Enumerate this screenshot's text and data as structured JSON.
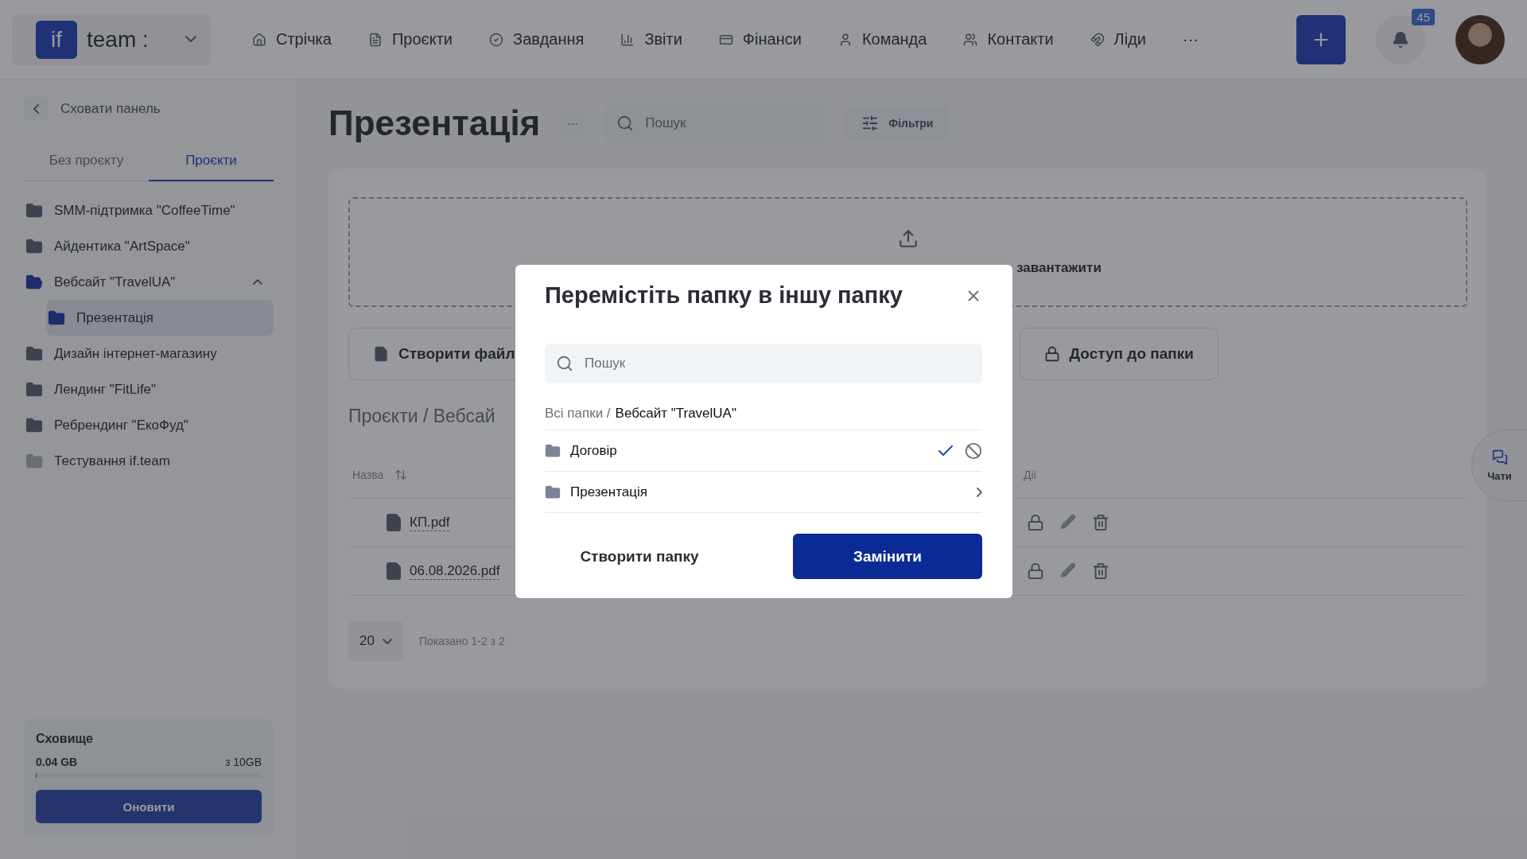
{
  "logo": {
    "mark": "if",
    "name": "team :"
  },
  "nav": [
    {
      "kind": "home",
      "label": "Стрічка"
    },
    {
      "kind": "file",
      "label": "Проєкти"
    },
    {
      "kind": "check",
      "label": "Завдання"
    },
    {
      "kind": "report",
      "label": "Звіти"
    },
    {
      "kind": "wallet",
      "label": "Фінанси"
    },
    {
      "kind": "user",
      "label": "Команда"
    },
    {
      "kind": "users",
      "label": "Контакти"
    },
    {
      "kind": "leads",
      "label": "Ліди"
    },
    {
      "kind": "more",
      "label": "···"
    }
  ],
  "notifications": {
    "count": "45"
  },
  "sidebar": {
    "hide": "Сховати панель",
    "tabs": [
      {
        "label": "Без проєкту",
        "selected": false
      },
      {
        "label": "Проєкти",
        "selected": true
      }
    ],
    "items": [
      {
        "label": "SMM-підтримка \"CoffeeTime\"",
        "selected": false,
        "inactive": false
      },
      {
        "label": "Айдентика \"ArtSpace\"",
        "selected": false,
        "inactive": false
      },
      {
        "label": "Вебсайт \"TravelUA\"",
        "selected": false,
        "inactive": false,
        "expanded": true,
        "children": [
          {
            "label": "Презентація",
            "selected": true,
            "inactive": false
          }
        ]
      },
      {
        "label": "Дизайн інтернет-магазину",
        "selected": false,
        "inactive": false
      },
      {
        "label": "Лендинг \"FitLife\"",
        "selected": false,
        "inactive": false
      },
      {
        "label": "Ребрендинг \"ЕкоФуд\"",
        "selected": false,
        "inactive": false
      },
      {
        "label": "Тестування if.team",
        "selected": false,
        "inactive": true
      }
    ],
    "storage": {
      "title": "Сховище",
      "used": "0.04 GB",
      "total": "з 10GB",
      "level": 0.004,
      "button": "Оновити"
    }
  },
  "main": {
    "title": "Презентація",
    "more": "···",
    "search": {
      "placeholder": "Пошук"
    },
    "filters": "Фільтри",
    "upload": "завантажити",
    "actions": [
      "Створити файл",
      "Доступ до папки"
    ],
    "breadcrumb": "Проєкти / Вебсай",
    "table": {
      "columns": [
        "Назва",
        "Дії"
      ],
      "rows": [
        {
          "name": "КП.pdf"
        },
        {
          "name": "06.08.2026.pdf"
        }
      ]
    },
    "pagination": {
      "size": "20",
      "shown": "Показано 1-2 з 2"
    }
  },
  "chats": "Чати",
  "modal": {
    "title": "Перемістіть папку в іншу папку",
    "search": {
      "placeholder": "Пошук"
    },
    "breadcrumb": {
      "root": "Всі папки /",
      "current": "Вебсайт \"TravelUA\""
    },
    "rows": [
      {
        "kind": "edit",
        "label": "Договір"
      },
      {
        "kind": "folder",
        "label": "Презентація"
      }
    ],
    "buttons": [
      {
        "kind": "secondary",
        "label": "Створити папку"
      },
      {
        "kind": "primary",
        "label": "Замінити"
      }
    ]
  }
}
